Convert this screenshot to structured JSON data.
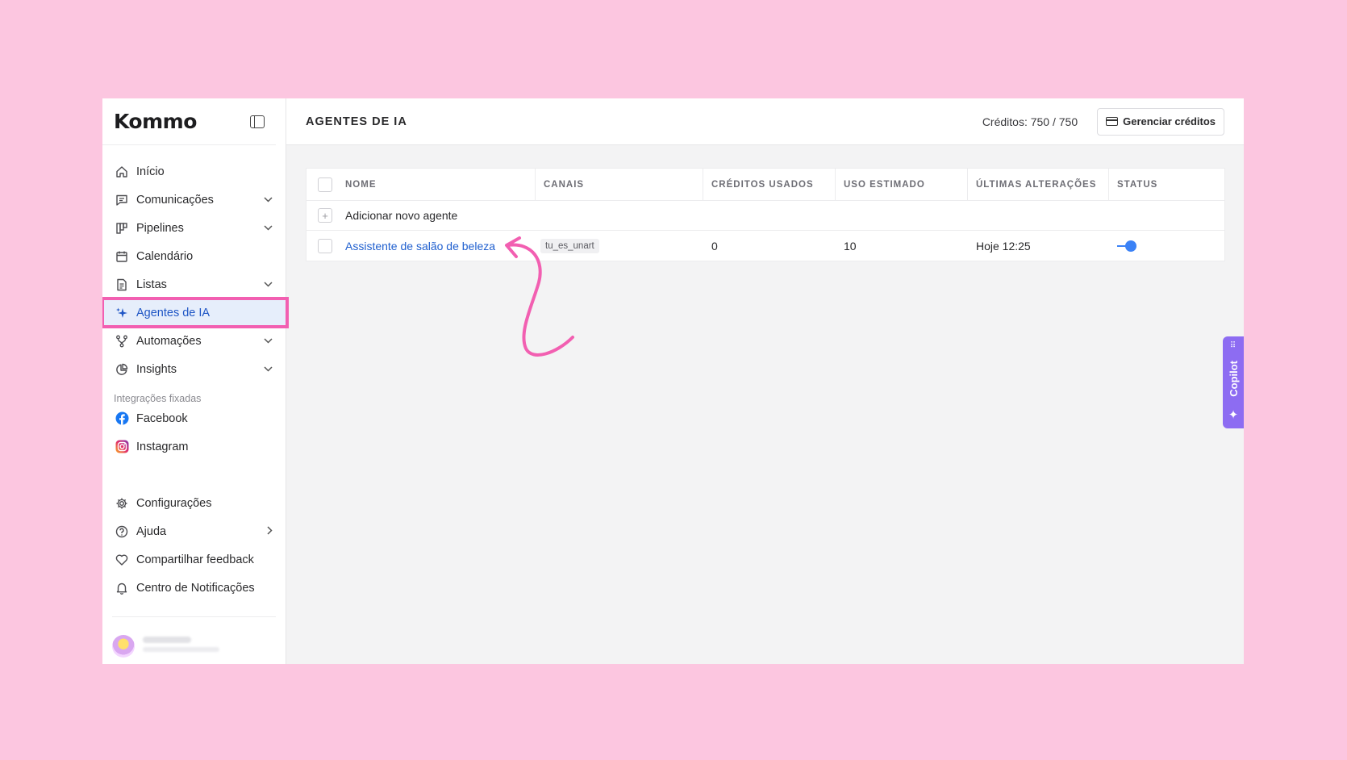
{
  "sidebar": {
    "logo": "Kommo",
    "items": [
      {
        "label": "Início",
        "icon": "home-icon"
      },
      {
        "label": "Comunicações",
        "icon": "chat-icon"
      },
      {
        "label": "Pipelines",
        "icon": "pipeline-icon"
      },
      {
        "label": "Calendário",
        "icon": "calendar-icon"
      },
      {
        "label": "Listas",
        "icon": "list-icon"
      },
      {
        "label": "Agentes de IA",
        "icon": "sparkle-icon"
      },
      {
        "label": "Automações",
        "icon": "automation-icon"
      },
      {
        "label": "Insights",
        "icon": "pie-chart-icon"
      }
    ],
    "pinned_label": "Integrações fixadas",
    "pinned": [
      {
        "label": "Facebook",
        "icon": "facebook-icon",
        "color": "#1877f2"
      },
      {
        "label": "Instagram",
        "icon": "instagram-icon",
        "color": "#e1306c"
      }
    ],
    "footer_items": [
      {
        "label": "Configurações",
        "icon": "gear-icon"
      },
      {
        "label": "Ajuda",
        "icon": "help-icon"
      },
      {
        "label": "Compartilhar feedback",
        "icon": "heart-icon"
      },
      {
        "label": "Centro de Notificações",
        "icon": "bell-icon"
      }
    ]
  },
  "header": {
    "title": "AGENTES DE IA",
    "credits": "Créditos: 750 / 750",
    "manage_button": "Gerenciar créditos"
  },
  "table": {
    "columns": [
      "NOME",
      "CANAIS",
      "CRÉDITOS USADOS",
      "USO ESTIMADO",
      "ÚLTIMAS ALTERAÇÕES",
      "STATUS"
    ],
    "add_label": "Adicionar novo agente",
    "rows": [
      {
        "name": "Assistente de salão de beleza",
        "channel": "tu_es_unart",
        "credits_used": "0",
        "estimated_use": "10",
        "last_change": "Hoje 12:25",
        "status": "on"
      }
    ]
  },
  "copilot": {
    "label": "Copilot"
  },
  "colors": {
    "background": "#fcc6e0",
    "accent": "#1f5fcf",
    "highlight": "#f25fb1",
    "copilot": "#8d6cf2",
    "toggle": "#3b82f6"
  }
}
